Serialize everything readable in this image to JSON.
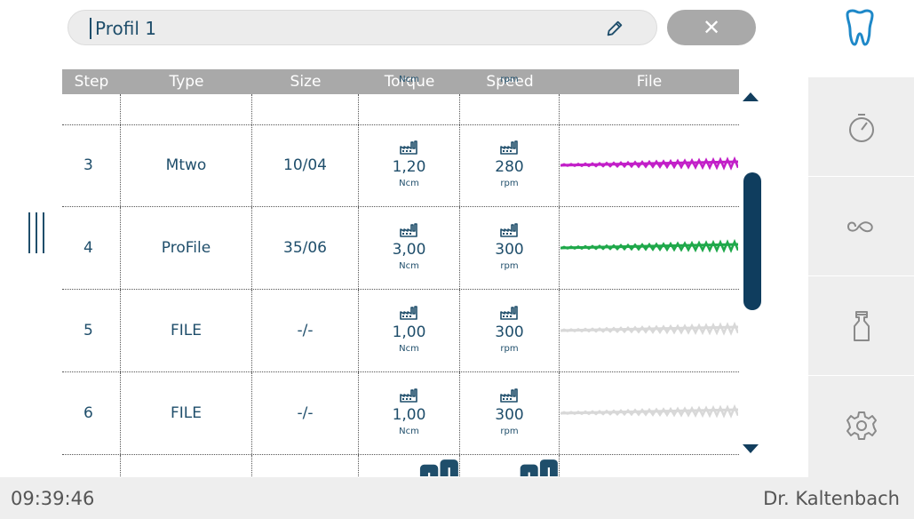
{
  "profile": {
    "name": "Profil 1"
  },
  "table": {
    "headers": [
      "Step",
      "Type",
      "Size",
      "Torque",
      "Speed",
      "File"
    ],
    "top_partial": {
      "torque_unit": "Ncm",
      "speed_unit": "rpm"
    },
    "rows": [
      {
        "step": "3",
        "type": "Mtwo",
        "size": "10/04",
        "torque": "1,20",
        "torque_unit": "Ncm",
        "speed": "280",
        "speed_unit": "rpm",
        "file_color": "#c21fc8"
      },
      {
        "step": "4",
        "type": "ProFile",
        "size": "35/06",
        "torque": "3,00",
        "torque_unit": "Ncm",
        "speed": "300",
        "speed_unit": "rpm",
        "file_color": "#1fa84a"
      },
      {
        "step": "5",
        "type": "FILE",
        "size": "-/-",
        "torque": "1,00",
        "torque_unit": "Ncm",
        "speed": "300",
        "speed_unit": "rpm",
        "file_color": "#d8d8d8"
      },
      {
        "step": "6",
        "type": "FILE",
        "size": "-/-",
        "torque": "1,00",
        "torque_unit": "Ncm",
        "speed": "300",
        "speed_unit": "rpm",
        "file_color": "#d8d8d8"
      }
    ]
  },
  "footer": {
    "time": "09:39:46",
    "user": "Dr. Kaltenbach"
  },
  "icons": {
    "rail": [
      "stopwatch-icon",
      "infinity-icon",
      "spray-bottle-icon",
      "settings-gear-icon"
    ],
    "top_right": "tooth-icon"
  },
  "colors": {
    "accent": "#123e5e",
    "header": "#a9a9a9",
    "rail": "#eeeeee"
  }
}
